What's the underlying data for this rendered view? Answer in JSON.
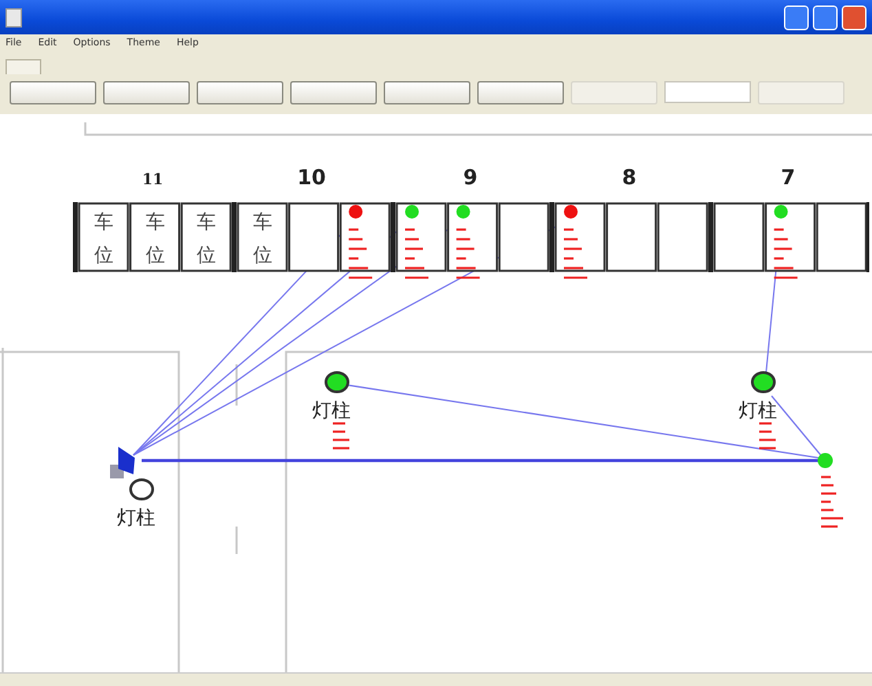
{
  "menu": [
    "File",
    "Edit",
    "Options",
    "Theme",
    "Help"
  ],
  "toolbar": {
    "buttons": [
      {
        "disabled": false
      },
      {
        "disabled": false
      },
      {
        "disabled": false
      },
      {
        "disabled": false
      },
      {
        "disabled": false
      },
      {
        "disabled": false
      },
      {
        "disabled": true
      },
      {
        "kind": "field"
      },
      {
        "disabled": true
      }
    ]
  },
  "parking": {
    "groups": [
      {
        "number": "11",
        "slots": [
          {
            "kind": "label",
            "label": "车位"
          },
          {
            "kind": "label",
            "label": "车位"
          },
          {
            "kind": "label",
            "label": "车位"
          }
        ]
      },
      {
        "number": "10",
        "slots": [
          {
            "kind": "label",
            "label": "车位"
          },
          {
            "kind": "empty"
          },
          {
            "kind": "sensor",
            "sensor": {
              "color": "#ee1111"
            }
          }
        ]
      },
      {
        "number": "9",
        "slots": [
          {
            "kind": "sensor",
            "sensor": {
              "color": "#22dd22"
            }
          },
          {
            "kind": "sensor",
            "sensor": {
              "color": "#22dd22"
            }
          },
          {
            "kind": "empty"
          }
        ]
      },
      {
        "number": "8",
        "slots": [
          {
            "kind": "sensor",
            "sensor": {
              "color": "#ee1111"
            }
          },
          {
            "kind": "empty"
          },
          {
            "kind": "empty"
          }
        ]
      },
      {
        "number": "7",
        "slots": [
          {
            "kind": "empty"
          },
          {
            "kind": "sensor",
            "sensor": {
              "color": "#22dd22"
            }
          },
          {
            "kind": "empty"
          }
        ]
      }
    ]
  },
  "lamps": [
    {
      "label": "灯柱",
      "lit": true
    },
    {
      "label": "灯柱",
      "lit": true
    },
    {
      "label": "灯柱",
      "lit": false
    }
  ],
  "relay": {
    "color": "#22dd22"
  }
}
